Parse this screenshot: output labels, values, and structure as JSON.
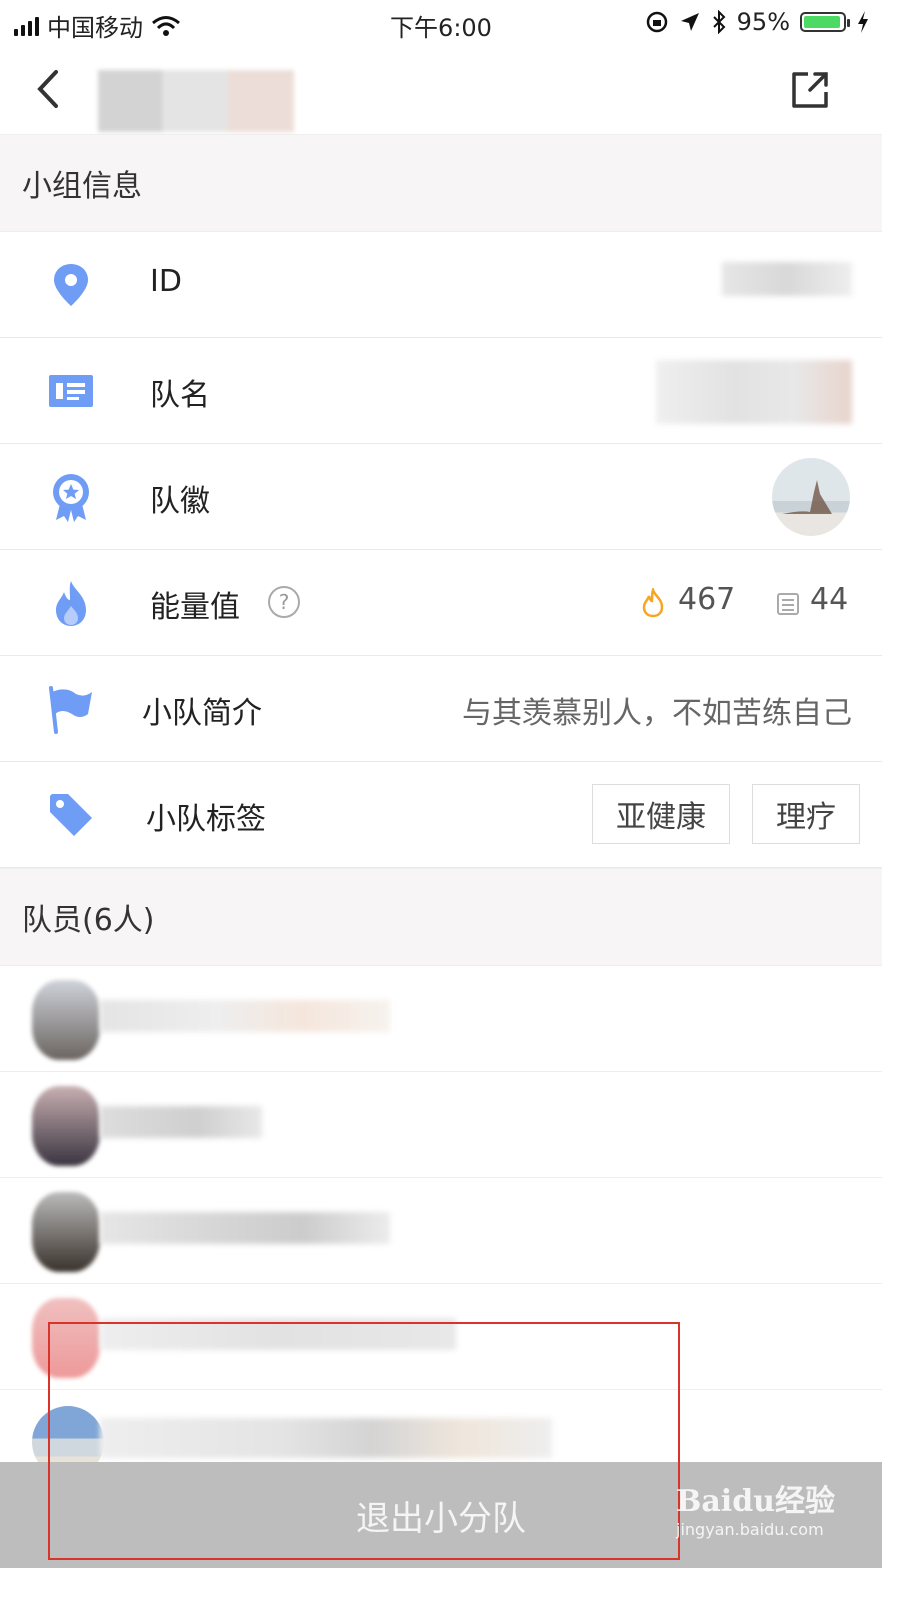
{
  "status_bar": {
    "carrier": "中国移动",
    "time": "下午6:00",
    "battery_percent": "95%",
    "battery_level": 0.95,
    "icons": [
      "signal-icon",
      "wifi-icon",
      "rotation-lock-icon",
      "location-icon",
      "bluetooth-icon",
      "battery-icon",
      "charging-icon"
    ]
  },
  "nav": {
    "back_icon": "chevron-left-icon",
    "share_icon": "share-icon"
  },
  "group_info": {
    "section_title": "小组信息",
    "rows": [
      {
        "icon": "location-pin-icon",
        "label": "ID"
      },
      {
        "icon": "id-card-icon",
        "label": "队名"
      },
      {
        "icon": "badge-icon",
        "label": "队徽"
      },
      {
        "icon": "flame-icon",
        "label": "能量值",
        "help": "?",
        "energy": "467",
        "days": "44"
      },
      {
        "icon": "flag-icon",
        "label": "小队简介",
        "value": "与其羡慕别人，不如苦练自己"
      },
      {
        "icon": "tag-icon",
        "label": "小队标签",
        "tags": [
          "亚健康",
          "理疗"
        ]
      }
    ]
  },
  "members": {
    "section_title": "队员(6人)"
  },
  "footer": {
    "exit_label": "退出小分队"
  },
  "watermark": {
    "logo": "Baidu经验",
    "url": "jingyan.baidu.com"
  },
  "colors": {
    "accent_icon": "#6f9cf5",
    "flame_orange": "#f5a623",
    "highlight_box": "#d9342b",
    "exit_bar": "#bdbdbd"
  }
}
